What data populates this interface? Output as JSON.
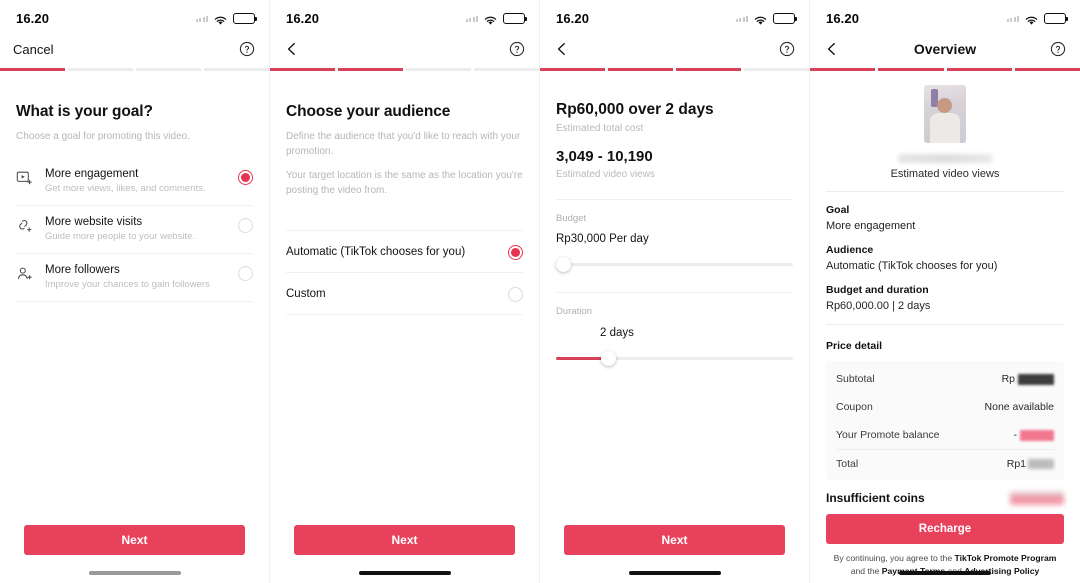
{
  "status": {
    "time": "16.20"
  },
  "panel1": {
    "nav": {
      "cancel_label": "Cancel",
      "help_icon": "help-circle-icon"
    },
    "progress": {
      "total": 4,
      "filled": 1
    },
    "heading": "What is your goal?",
    "subtitle": "Choose a goal for promoting this video.",
    "options": [
      {
        "icon": "video-plus-icon",
        "title": "More engagement",
        "desc": "Get more views, likes, and comments.",
        "selected": true
      },
      {
        "icon": "link-plus-icon",
        "title": "More website visits",
        "desc": "Guide more people to your website.",
        "selected": false
      },
      {
        "icon": "person-plus-icon",
        "title": "More followers",
        "desc": "Improve your chances to gain followers",
        "selected": false
      }
    ],
    "next_label": "Next"
  },
  "panel2": {
    "nav": {
      "back_icon": "chevron-left-icon",
      "help_icon": "help-circle-icon"
    },
    "progress": {
      "total": 4,
      "filled": 2
    },
    "heading": "Choose your audience",
    "subtitle1": "Define the audience that you'd like to reach with your promotion.",
    "subtitle2": "Your target location is the same as the location you're posting the video from.",
    "options": [
      {
        "label": "Automatic (TikTok chooses for you)",
        "selected": true
      },
      {
        "label": "Custom",
        "selected": false
      }
    ],
    "next_label": "Next"
  },
  "panel3": {
    "nav": {
      "back_icon": "chevron-left-icon",
      "help_icon": "help-circle-icon"
    },
    "progress": {
      "total": 4,
      "filled": 3
    },
    "total_cost": "Rp60,000 over 2 days",
    "total_cost_caption": "Estimated total cost",
    "views_range": "3,049 - 10,190",
    "views_caption": "Estimated video views",
    "budget": {
      "label": "Budget",
      "value": "Rp30,000 Per day",
      "slider_percent": 2
    },
    "duration": {
      "label": "Duration",
      "value": "2 days",
      "slider_percent": 22
    },
    "next_label": "Next"
  },
  "panel4": {
    "nav": {
      "back_icon": "chevron-left-icon",
      "title": "Overview",
      "help_icon": "help-circle-icon"
    },
    "progress": {
      "total": 4,
      "filled": 4
    },
    "thumbnail": "video-thumbnail",
    "views_caption": "Estimated video views",
    "summary": [
      {
        "key": "Goal",
        "value": "More engagement"
      },
      {
        "key": "Audience",
        "value": "Automatic (TikTok chooses for you)"
      },
      {
        "key": "Budget and duration",
        "value": "Rp60,000.00 | 2 days"
      }
    ],
    "price_detail": {
      "title": "Price detail",
      "rows": [
        {
          "label": "Subtotal",
          "value": "Rp",
          "redacted": "black"
        },
        {
          "label": "Coupon",
          "value": "None available",
          "redacted": "none"
        },
        {
          "label": "Your Promote balance",
          "value": "-",
          "redacted": "pink"
        },
        {
          "label": "Total",
          "value": "Rp1",
          "redacted": "grey"
        }
      ]
    },
    "insufficient": {
      "label": "Insufficient coins",
      "redacted": true
    },
    "cta_label": "Recharge",
    "legal": {
      "part1": "By continuing, you agree to the ",
      "link1": "TikTok Promote Program",
      "part2": " and the ",
      "link2": "Payment Terms",
      "part3": " and ",
      "link3": "Advertising Policy"
    }
  },
  "colors": {
    "accent": "#e8415c",
    "progress_on": "#d8415a",
    "muted": "#b6b6b6"
  }
}
